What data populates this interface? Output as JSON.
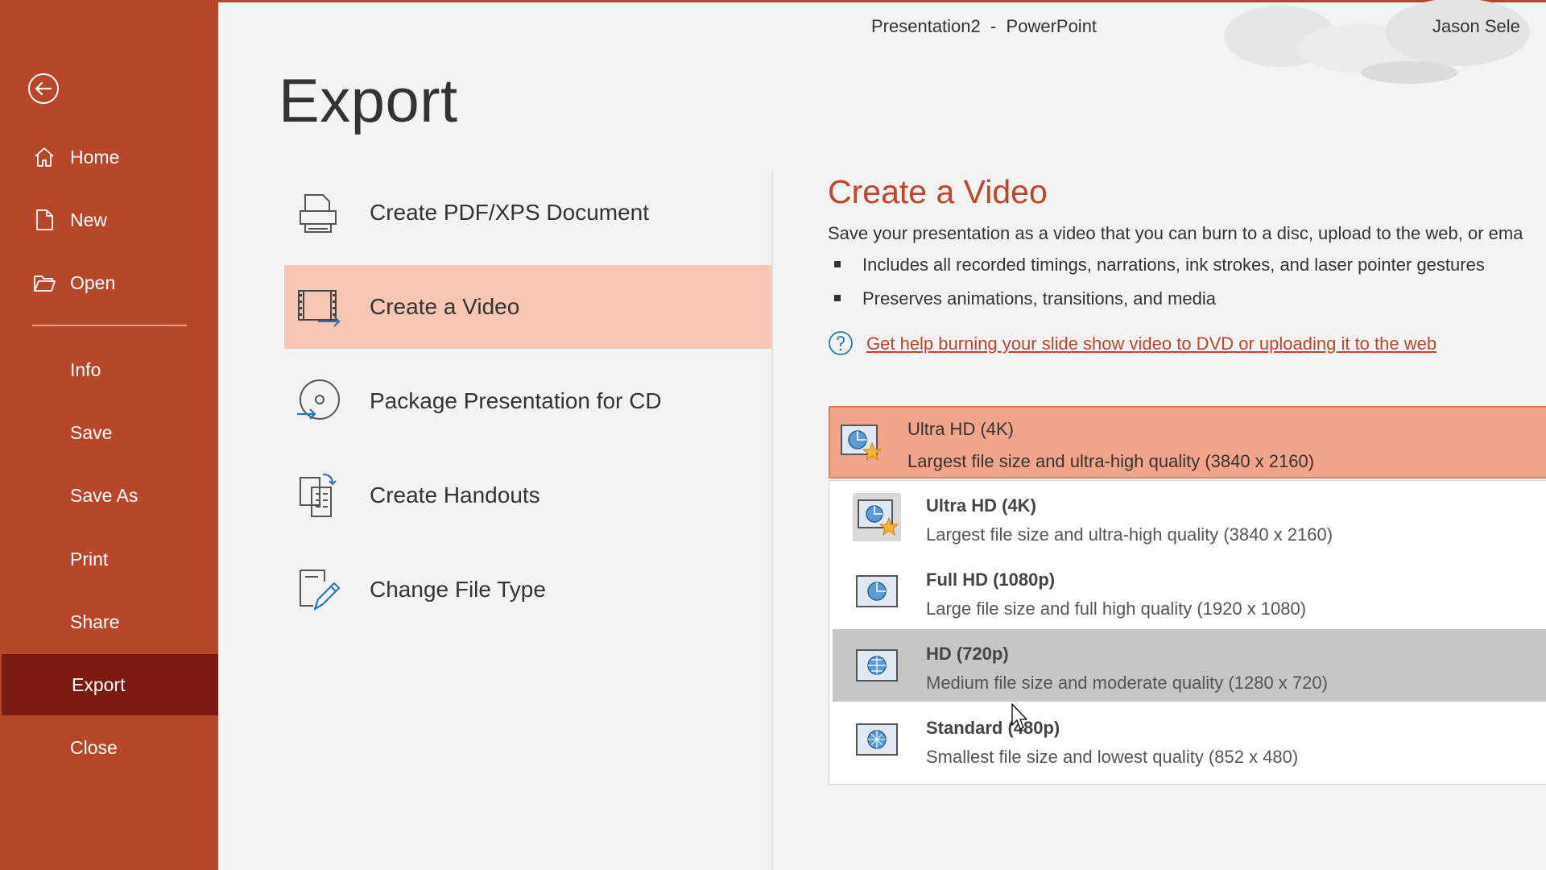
{
  "window": {
    "title": "Presentation2  -  PowerPoint",
    "user": "Jason Sele"
  },
  "sidebar": {
    "back_icon": "back-arrow-icon",
    "items": [
      {
        "label": "Home",
        "icon": "home-icon"
      },
      {
        "label": "New",
        "icon": "new-document-icon"
      },
      {
        "label": "Open",
        "icon": "folder-open-icon"
      },
      {
        "label": "Info"
      },
      {
        "label": "Save"
      },
      {
        "label": "Save As"
      },
      {
        "label": "Print"
      },
      {
        "label": "Share"
      },
      {
        "label": "Export",
        "active": true
      },
      {
        "label": "Close"
      }
    ],
    "accent_color": "#b7472a",
    "active_color": "#7a1a11"
  },
  "main": {
    "title": "Export",
    "options": [
      {
        "label": "Create PDF/XPS Document",
        "icon": "pdf-document-icon"
      },
      {
        "label": "Create a Video",
        "icon": "video-film-icon",
        "selected": true
      },
      {
        "label": "Package Presentation for CD",
        "icon": "cd-package-icon"
      },
      {
        "label": "Create Handouts",
        "icon": "handouts-icon"
      },
      {
        "label": "Change File Type",
        "icon": "change-file-type-icon"
      }
    ]
  },
  "panel": {
    "title": "Create a Video",
    "description": "Save your presentation as a video that you can burn to a disc, upload to the web, or ema",
    "bullets": [
      "Includes all recorded timings, narrations, ink strokes, and laser pointer gestures",
      "Preserves animations, transitions, and media"
    ],
    "help_link": "Get help burning your slide show video to DVD or uploading it to the web",
    "quality_selected": {
      "name": "Ultra HD (4K)",
      "desc": "Largest file size and ultra-high quality (3840 x 2160)"
    },
    "quality_options": [
      {
        "name": "Ultra HD (4K)",
        "desc": "Largest file size and ultra-high quality (3840 x 2160)",
        "icon": "ultra-hd-quality-icon"
      },
      {
        "name": "Full HD (1080p)",
        "desc": "Large file size and full high quality (1920 x 1080)",
        "icon": "full-hd-quality-icon"
      },
      {
        "name": "HD (720p)",
        "desc": "Medium file size and moderate quality (1280 x 720)",
        "icon": "hd-quality-icon",
        "hover": true
      },
      {
        "name": "Standard (480p)",
        "desc": "Smallest file size and lowest quality (852 x 480)",
        "icon": "standard-quality-icon"
      }
    ],
    "accent_color": "#c0452a",
    "highlight_color": "#f2a58a"
  }
}
